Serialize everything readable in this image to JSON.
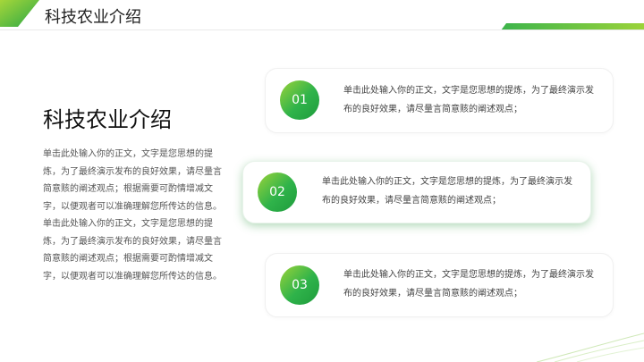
{
  "header": {
    "title": "科技农业介绍"
  },
  "intro": {
    "title": "科技农业介绍",
    "body": "单击此处输入你的正文，文字是您思想的提炼，为了最终演示发布的良好效果，请尽量言简意赅的阐述观点；根据需要可酌情增减文字，以便观者可以准确理解您所传达的信息。单击此处输入你的正文，文字是您思想的提炼，为了最终演示发布的良好效果，请尽量言简意赅的阐述观点；根据需要可酌情增减文字，以便观者可以准确理解您所传达的信息。"
  },
  "cards": [
    {
      "num": "01",
      "text": "单击此处输入你的正文，文字是您思想的提炼，为了最终演示发布的良好效果，请尽量言简意赅的阐述观点；"
    },
    {
      "num": "02",
      "text": "单击此处输入你的正文，文字是您思想的提炼，为了最终演示发布的良好效果，请尽量言简意赅的阐述观点；"
    },
    {
      "num": "03",
      "text": "单击此处输入你的正文，文字是您思想的提炼，为了最终演示发布的良好效果，请尽量言简意赅的阐述观点；"
    }
  ],
  "colors": {
    "accent_green": "#2fb34a",
    "accent_light": "#9bd33a"
  }
}
